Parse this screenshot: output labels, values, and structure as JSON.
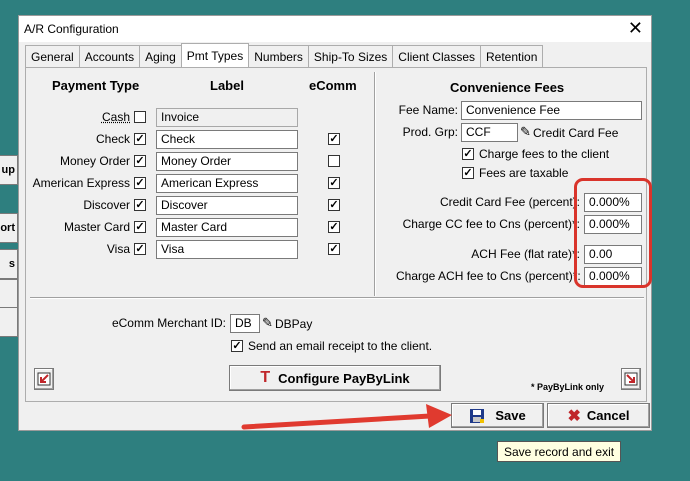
{
  "background_buttons": [
    "up",
    "ort",
    "s",
    "",
    ""
  ],
  "window": {
    "title": "A/R Configuration",
    "close_glyph": "✕"
  },
  "tabs": [
    "General",
    "Accounts",
    "Aging",
    "Pmt Types",
    "Numbers",
    "Ship-To Sizes",
    "Client Classes",
    "Retention"
  ],
  "active_tab": "Pmt Types",
  "payment_types": {
    "headers": {
      "type": "Payment Type",
      "label": "Label",
      "ecomm": "eComm"
    },
    "rows": [
      {
        "name": "Cash",
        "enabled": false,
        "label": "Invoice",
        "ecomm": null,
        "readonly": true
      },
      {
        "name": "Check",
        "enabled": true,
        "label": "Check",
        "ecomm": true,
        "readonly": false
      },
      {
        "name": "Money Order",
        "enabled": true,
        "label": "Money Order",
        "ecomm": false,
        "readonly": false
      },
      {
        "name": "American Express",
        "enabled": true,
        "label": "American Express",
        "ecomm": true,
        "readonly": false
      },
      {
        "name": "Discover",
        "enabled": true,
        "label": "Discover",
        "ecomm": true,
        "readonly": false
      },
      {
        "name": "Master Card",
        "enabled": true,
        "label": "Master Card",
        "ecomm": true,
        "readonly": false
      },
      {
        "name": "Visa",
        "enabled": true,
        "label": "Visa",
        "ecomm": true,
        "readonly": false
      }
    ]
  },
  "convenience_fees": {
    "title": "Convenience Fees",
    "fee_name_label": "Fee Name:",
    "fee_name_value": "Convenience Fee",
    "prod_grp_label": "Prod. Grp:",
    "prod_grp_value": "CCF",
    "prod_grp_desc": "Credit Card Fee",
    "charge_client_label": "Charge fees to the client",
    "charge_client_checked": true,
    "taxable_label": "Fees are taxable",
    "taxable_checked": true,
    "cc_fee_label": "Credit Card Fee (percent):",
    "cc_fee_value": "0.000%",
    "cc_cns_label": "Charge CC fee to Cns (percent)*:",
    "cc_cns_value": "0.000%",
    "ach_fee_label": "ACH Fee (flat rate)*:",
    "ach_fee_value": "0.00",
    "ach_cns_label": "Charge ACH fee to Cns (percent)*:",
    "ach_cns_value": "0.000%"
  },
  "ecomm": {
    "merchant_label": "eComm Merchant ID:",
    "merchant_value": "DB",
    "merchant_desc": "DBPay",
    "email_receipt_label": "Send an email receipt to the client.",
    "email_receipt_checked": true,
    "configure_label": "Configure PayByLink",
    "footnote": "* PayByLink only"
  },
  "footer": {
    "save_label": "Save",
    "cancel_label": "Cancel"
  },
  "tooltip": "Save record and exit",
  "colors": {
    "highlight_box": "#d9342b",
    "arrow": "#e03a2f",
    "background": "#2e7f7f"
  }
}
